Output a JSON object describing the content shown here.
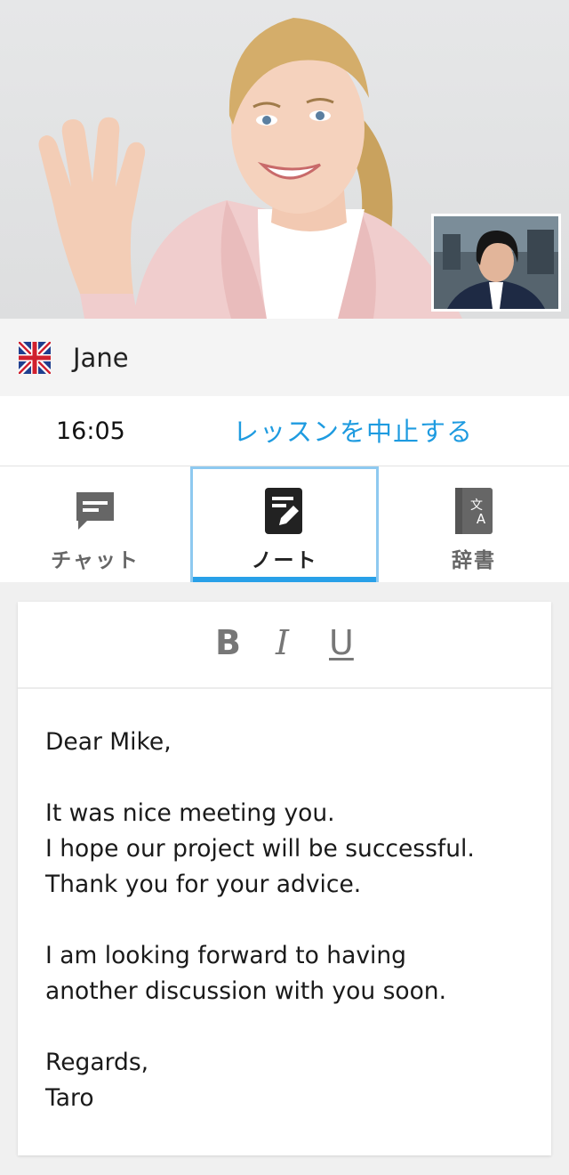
{
  "tutor": {
    "name": "Jane",
    "flag": "uk-flag-icon"
  },
  "lesson": {
    "timer": "16:05",
    "stop_label": "レッスンを中止する",
    "link_color": "#1e9be0"
  },
  "tabs": [
    {
      "label": "チャット",
      "icon": "chat-icon",
      "active": false
    },
    {
      "label": "ノート",
      "icon": "note-edit-icon",
      "active": true
    },
    {
      "label": "辞書",
      "icon": "dictionary-icon",
      "active": false
    }
  ],
  "toolbar": {
    "bold_label": "B",
    "italic_label": "I",
    "underline_label": "U"
  },
  "note": {
    "lines": [
      "Dear Mike,",
      "",
      "It was nice meeting you.",
      "I hope our project will be successful.",
      "Thank you for your advice.",
      "",
      "I am looking forward to having",
      "another discussion with you soon.",
      "",
      "Regards,",
      "Taro"
    ]
  }
}
